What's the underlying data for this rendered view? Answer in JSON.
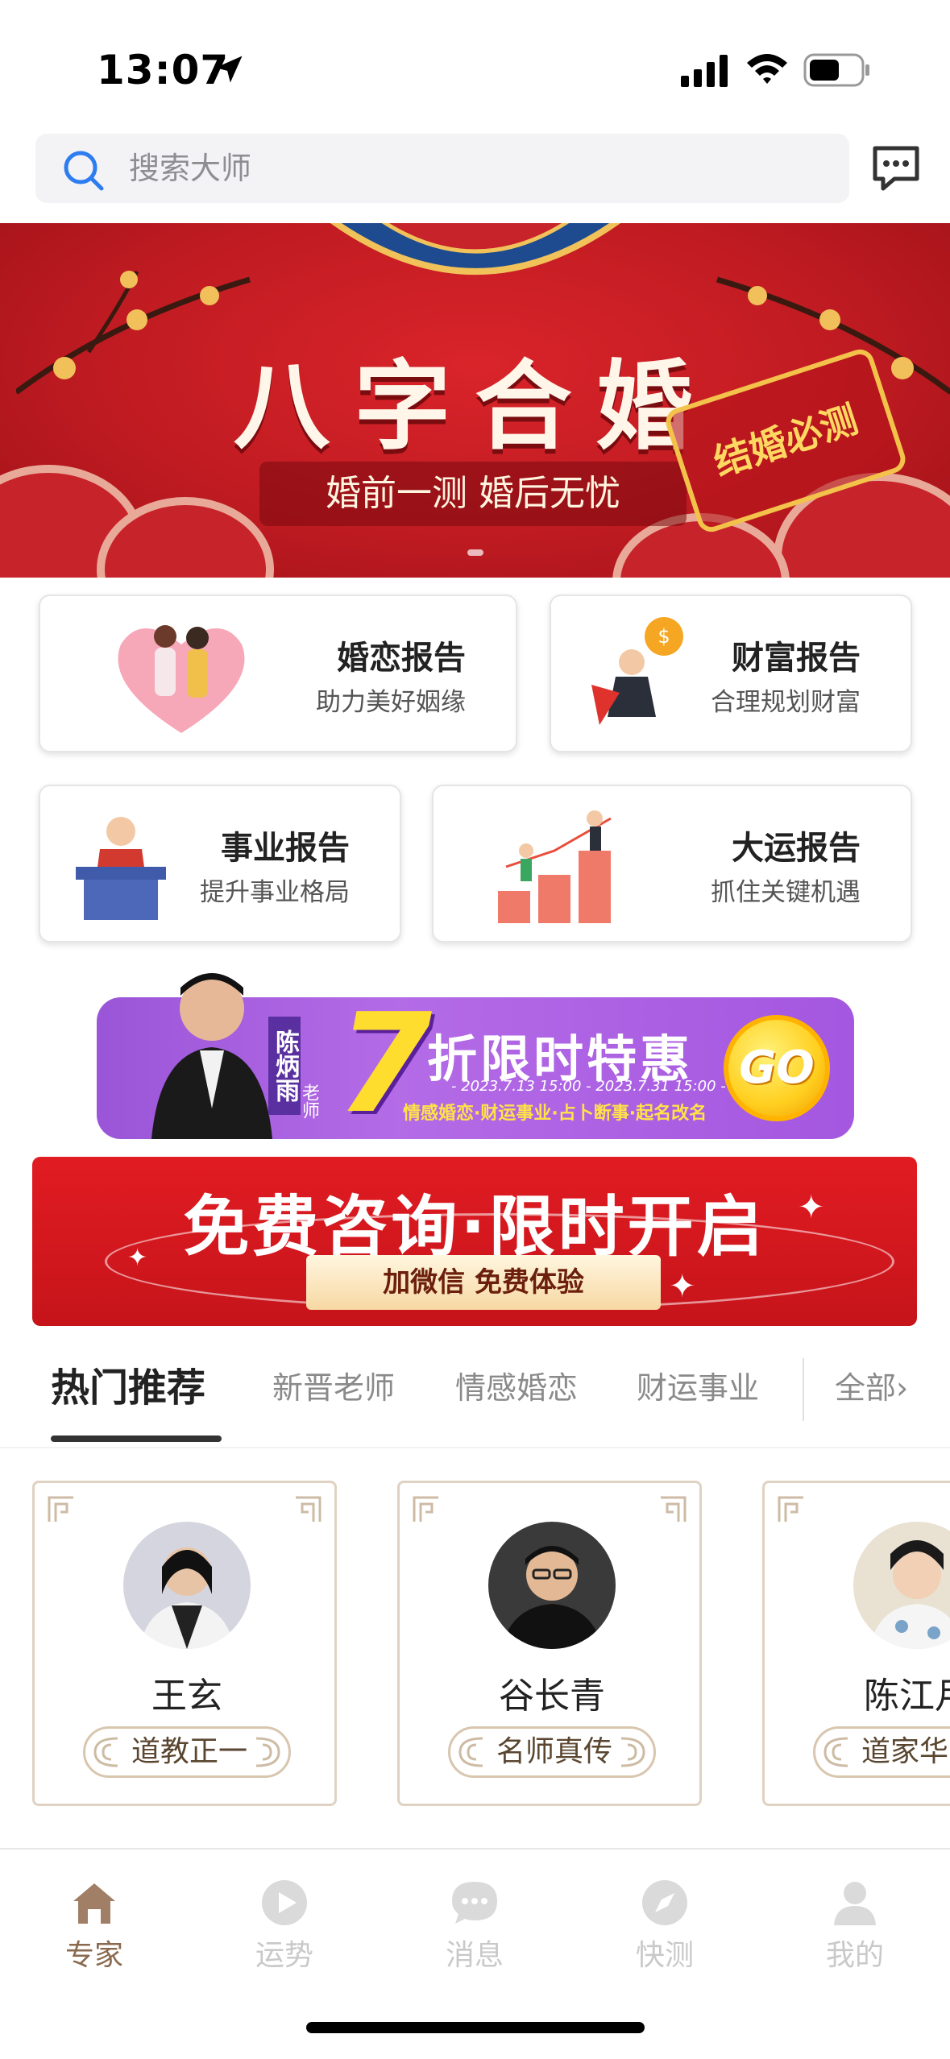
{
  "status_bar": {
    "time": "13:07"
  },
  "search": {
    "placeholder": "搜索大师"
  },
  "hero": {
    "title": "八字合婚",
    "subtitle": "婚前一测  婚后无忧",
    "stamp": "结婚必测"
  },
  "reports": [
    {
      "title": "婚恋报告",
      "subtitle": "助力美好姻缘"
    },
    {
      "title": "财富报告",
      "subtitle": "合理规划财富"
    },
    {
      "title": "事业报告",
      "subtitle": "提升事业格局"
    },
    {
      "title": "大运报告",
      "subtitle": "抓住关键机遇"
    }
  ],
  "promo_discount": {
    "teacher_name": "陈炳雨",
    "teacher_title": "老师",
    "discount_number": "7",
    "headline": "折限时特惠",
    "dates": "- 2023.7.13  15:00  -  2023.7.31  15:00 -",
    "tags": "情感婚恋·财运事业·占卜断事·起名改名",
    "coin": "GO"
  },
  "promo_free": {
    "title": "免费咨询·限时开启",
    "subtitle": "加微信 免费体验"
  },
  "tabs": {
    "items": [
      "热门推荐",
      "新晋老师",
      "情感婚恋",
      "财运事业"
    ],
    "all_label": "全部",
    "all_chevron": "›"
  },
  "masters": [
    {
      "name": "王玄",
      "tag": "道教正一"
    },
    {
      "name": "谷长青",
      "tag": "名师真传"
    },
    {
      "name": "陈江月",
      "tag": "道家华山"
    }
  ],
  "bottom_nav": [
    {
      "label": "专家",
      "icon": "home-icon",
      "active": true
    },
    {
      "label": "运势",
      "icon": "play-circle-icon",
      "active": false
    },
    {
      "label": "消息",
      "icon": "chat-bubble-icon",
      "active": false
    },
    {
      "label": "快测",
      "icon": "compass-icon",
      "active": false
    },
    {
      "label": "我的",
      "icon": "person-icon",
      "active": false
    }
  ],
  "colors": {
    "brand_red": "#c7232a",
    "nav_active": "#8a6a4e",
    "nav_inactive": "#c9c9c9",
    "card_border": "#dfd2c2"
  }
}
